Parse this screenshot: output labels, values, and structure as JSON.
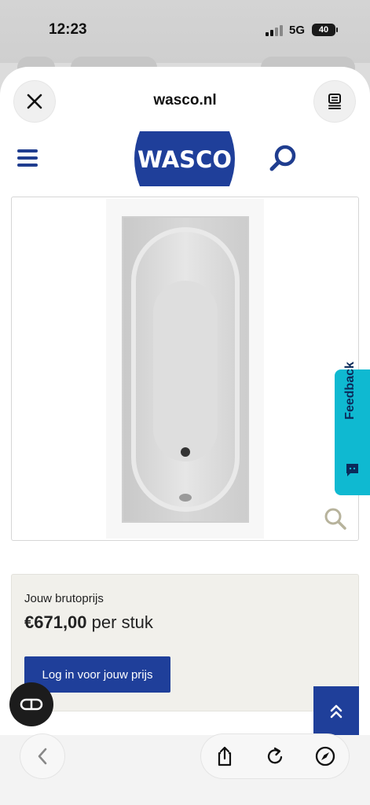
{
  "status_bar": {
    "time": "12:23",
    "network": "5G",
    "battery": "40"
  },
  "browser": {
    "domain": "wasco.nl"
  },
  "header": {
    "logo_text": "WASCO"
  },
  "feedback": {
    "label": "Feedback"
  },
  "price": {
    "label": "Jouw brutoprijs",
    "amount": "€671,00",
    "unit": "per stuk",
    "login_button": "Log in voor jouw prijs"
  },
  "colors": {
    "brand_blue": "#1f3f9a",
    "feedback_cyan": "#0fb9d1",
    "panel_bg": "#f1f0eb"
  },
  "icons": [
    "close-icon",
    "reader-icon",
    "menu-icon",
    "search-icon",
    "zoom-icon",
    "feedback-icon",
    "ar-icon",
    "chevron-up-icon",
    "chevron-left-icon",
    "share-icon",
    "reload-icon",
    "compass-icon"
  ]
}
